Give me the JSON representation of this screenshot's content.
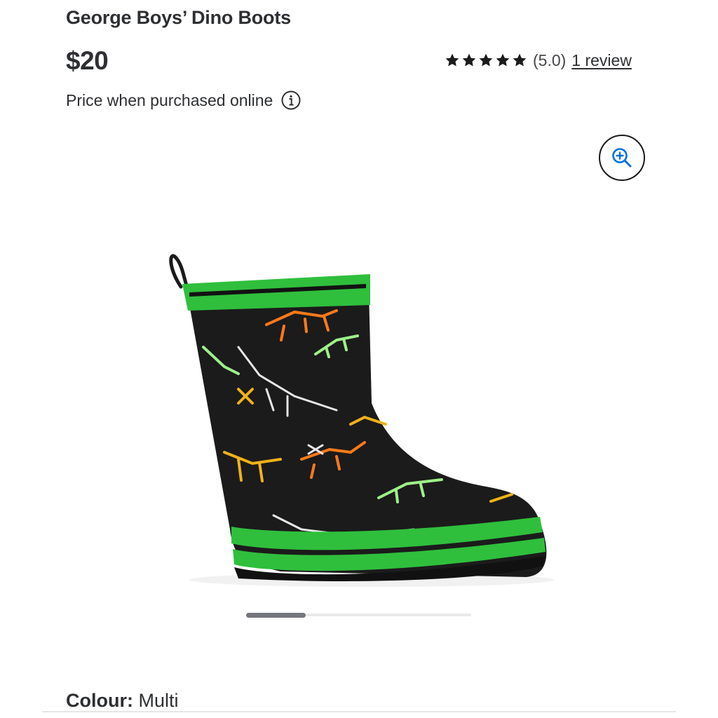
{
  "product": {
    "title": "George Boys’ Dino Boots",
    "price": "$20",
    "price_note": "Price when purchased online",
    "rating": {
      "stars": 5,
      "value_label": "(5.0)",
      "review_link": "1 review"
    },
    "colour": {
      "label": "Colour:",
      "value": "Multi"
    }
  },
  "gallery": {
    "current_image": 1,
    "scroll_position": 0.27
  },
  "icons": {
    "star": "star-icon",
    "info": "info-icon",
    "zoom": "zoom-in-icon"
  },
  "colors": {
    "text": "#2e2f32",
    "boot_green": "#2fbf3c",
    "boot_black": "#1b1b1b",
    "scroll_thumb": "#74767c"
  }
}
